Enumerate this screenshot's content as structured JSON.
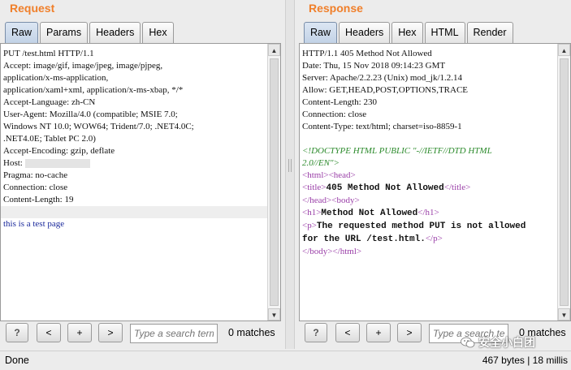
{
  "request": {
    "title": "Request",
    "tabs": [
      "Raw",
      "Params",
      "Headers",
      "Hex"
    ],
    "lines": [
      "PUT /test.html HTTP/1.1",
      "Accept: image/gif, image/jpeg, image/pjpeg,",
      "application/x-ms-application,",
      "application/xaml+xml, application/x-ms-xbap, */*",
      "Accept-Language: zh-CN",
      "User-Agent: Mozilla/4.0 (compatible; MSIE 7.0;",
      "Windows NT 10.0; WOW64; Trident/7.0; .NET4.0C;",
      ".NET4.0E; Tablet PC 2.0)",
      "Accept-Encoding: gzip, deflate",
      "Host:",
      "Pragma: no-cache",
      "Connection: close",
      "Content-Length: 19"
    ],
    "body": "this is a test page",
    "search_placeholder": "Type a search term",
    "matches": "0 matches"
  },
  "response": {
    "title": "Response",
    "tabs": [
      "Raw",
      "Headers",
      "Hex",
      "HTML",
      "Render"
    ],
    "headers": [
      "HTTP/1.1 405 Method Not Allowed",
      "Date: Thu, 15 Nov 2018 09:14:23 GMT",
      "Server: Apache/2.2.23 (Unix) mod_jk/1.2.14",
      "Allow: GET,HEAD,POST,OPTIONS,TRACE",
      "Content-Length: 230",
      "Connection: close",
      "Content-Type: text/html; charset=iso-8859-1"
    ],
    "doctype_1": "<!DOCTYPE HTML PUBLIC \"-//IETF//DTD HTML",
    "doctype_2": "2.0//EN\">",
    "html_open": "<html>",
    "head_open": "<head>",
    "title_open": "<title>",
    "title_text": "405 Method Not Allowed",
    "title_close": "</title>",
    "head_close": "</head>",
    "body_open": "<body>",
    "h1_open": "<h1>",
    "h1_text": "Method Not Allowed",
    "h1_close": "</h1>",
    "p_open": "<p>",
    "p_text_1": "The requested method PUT is not allowed",
    "p_text_2": "for the URL /test.html.",
    "p_close": "</p>",
    "body_close": "</body>",
    "html_close": "</html>",
    "search_placeholder": "Type a search term",
    "matches": "0 matches"
  },
  "buttons": {
    "help": "?",
    "prev": "<",
    "add": "+",
    "next": ">"
  },
  "scroll": {
    "up": "▲",
    "down": "▼"
  },
  "status": {
    "left": "Done",
    "right": "467 bytes | 18 millis"
  },
  "watermark": "安全小白团",
  "colors": {
    "title": "#f07f2a",
    "tag": "#9a3fa8",
    "doctype": "#2b8a2b",
    "request_body": "#1b2a9c"
  }
}
